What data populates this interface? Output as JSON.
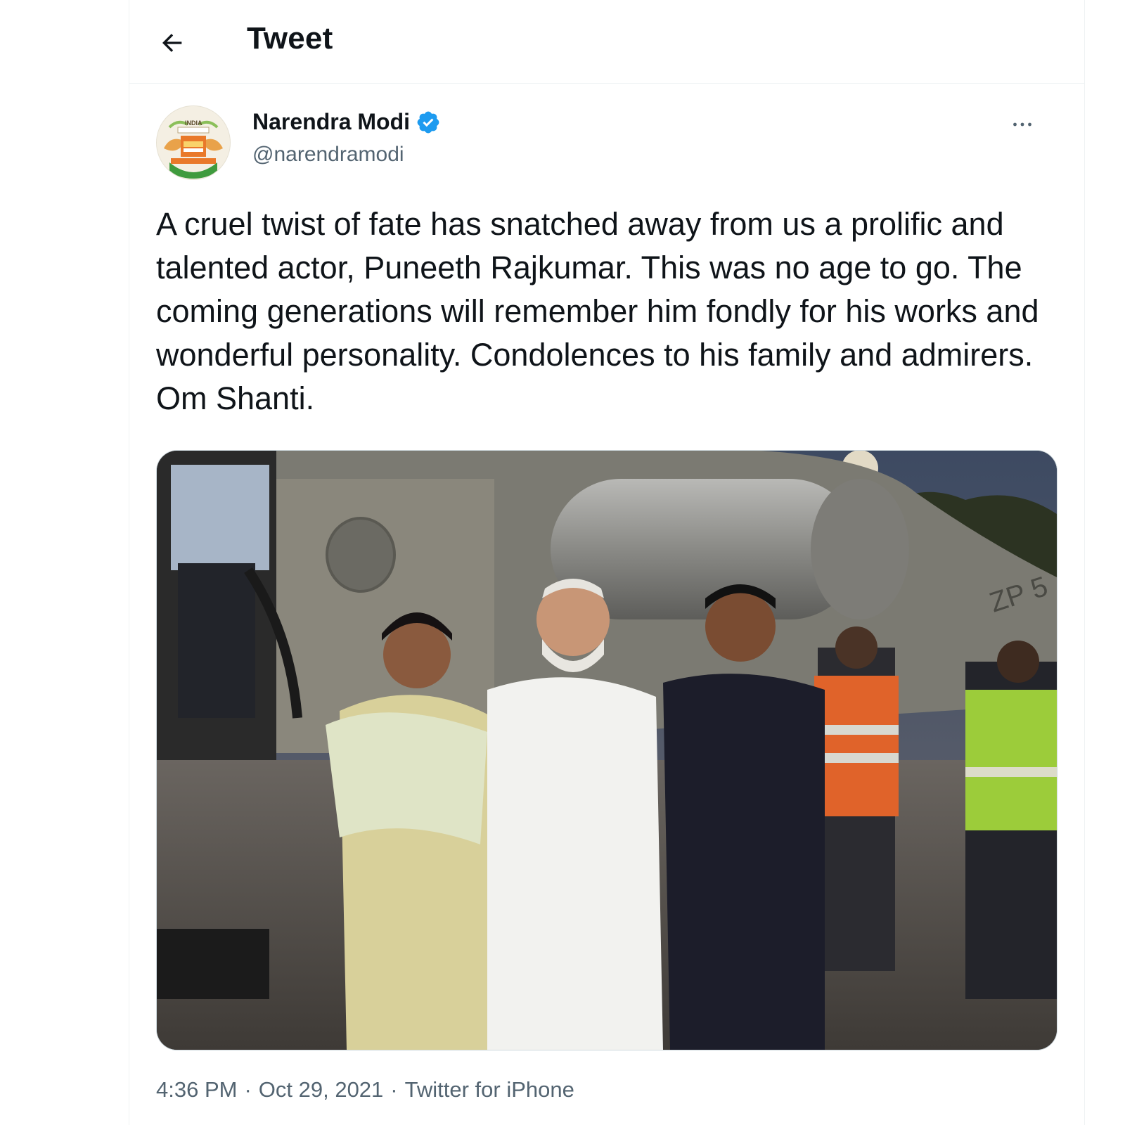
{
  "header": {
    "title": "Tweet",
    "back_icon": "arrow-left-icon"
  },
  "tweet": {
    "author": {
      "name": "Narendra Modi",
      "handle": "@narendramodi",
      "verified": true,
      "avatar_icon": "profile-avatar",
      "avatar_text": "INDIA"
    },
    "more_icon": "ellipsis-icon",
    "text": "A cruel twist of fate has snatched away from us a prolific and talented actor, Puneeth Rajkumar. This was no age to go. The coming generations will remember him fondly for his works and wonderful personality. Condolences to his family and admirers. Om Shanti.",
    "media": {
      "type": "photo",
      "helicopter_marking": "ZP 5"
    },
    "meta": {
      "time": "4:36 PM",
      "separator": "·",
      "date": "Oct 29, 2021",
      "source": "Twitter for iPhone"
    }
  },
  "colors": {
    "text_primary": "#0f1419",
    "text_secondary": "#536471",
    "verified_blue": "#1d9bf0",
    "border": "#eff3f4"
  }
}
